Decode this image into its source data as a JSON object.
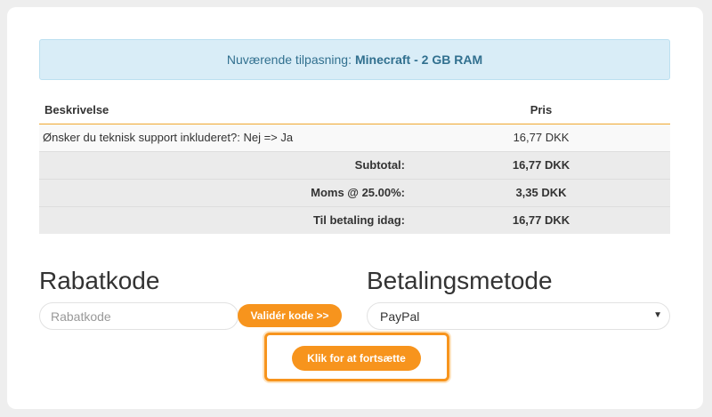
{
  "alert": {
    "prefix": "Nuværende tilpasning:",
    "product": "Minecraft - 2 GB RAM"
  },
  "table": {
    "headers": {
      "description": "Beskrivelse",
      "price": "Pris"
    },
    "items": [
      {
        "description": "Ønsker du teknisk support inkluderet?: Nej => Ja",
        "price": "16,77 DKK"
      }
    ],
    "subtotal": {
      "label": "Subtotal:",
      "value": "16,77 DKK"
    },
    "tax": {
      "label": "Moms @ 25.00%:",
      "value": "3,35 DKK"
    },
    "total_today": {
      "label": "Til betaling idag:",
      "value": "16,77 DKK"
    }
  },
  "promo": {
    "heading": "Rabatkode",
    "placeholder": "Rabatkode",
    "validate_label": "Validér kode >>"
  },
  "payment": {
    "heading": "Betalingsmetode",
    "selected": "PayPal"
  },
  "continue_label": "Klik for at fortsætte",
  "colors": {
    "accent": "#f7941d",
    "alert_bg": "#d9edf7",
    "alert_text": "#31708f"
  }
}
